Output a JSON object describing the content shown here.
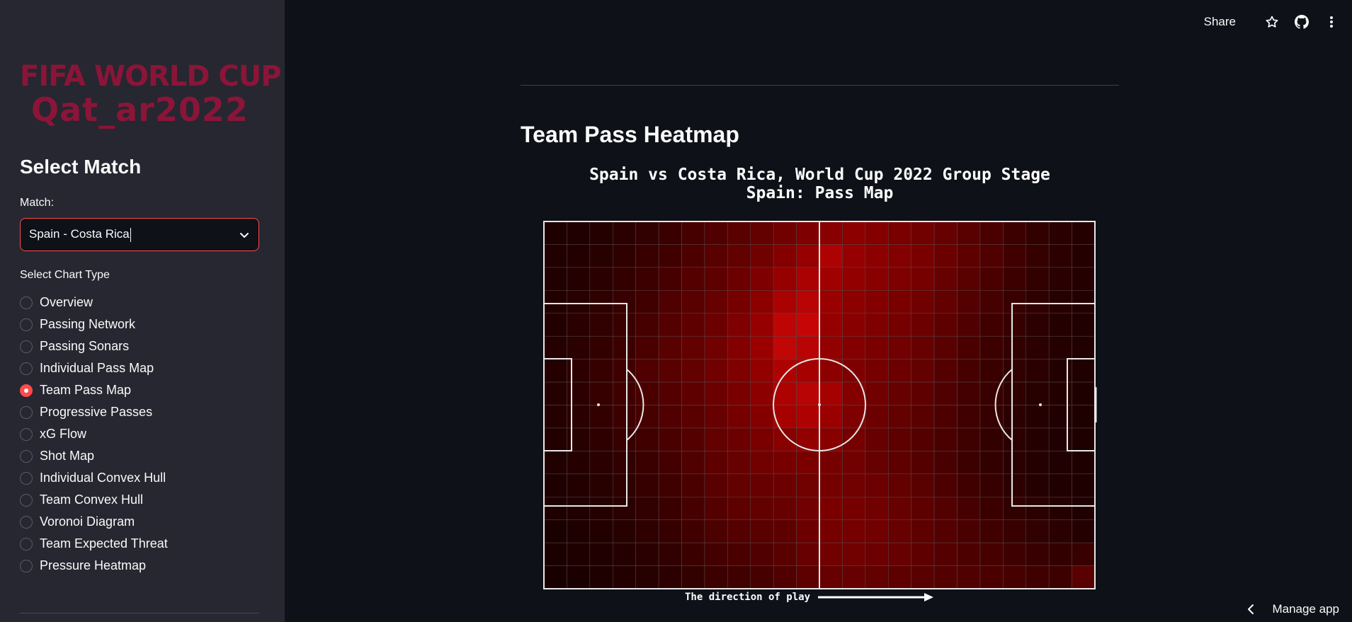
{
  "sidebar": {
    "logo": {
      "line1": "FIFA WORLD CUP",
      "line2": "Qat_ar2022"
    },
    "heading": "Select Match",
    "match_label": "Match:",
    "match_value": "Spain - Costa Rica",
    "chart_type_label": "Select Chart Type",
    "chart_types": [
      {
        "label": "Overview",
        "selected": false
      },
      {
        "label": "Passing Network",
        "selected": false
      },
      {
        "label": "Passing Sonars",
        "selected": false
      },
      {
        "label": "Individual Pass Map",
        "selected": false
      },
      {
        "label": "Team Pass Map",
        "selected": true
      },
      {
        "label": "Progressive Passes",
        "selected": false
      },
      {
        "label": "xG Flow",
        "selected": false
      },
      {
        "label": "Shot Map",
        "selected": false
      },
      {
        "label": "Individual Convex Hull",
        "selected": false
      },
      {
        "label": "Team Convex Hull",
        "selected": false
      },
      {
        "label": "Voronoi Diagram",
        "selected": false
      },
      {
        "label": "Team Expected Threat",
        "selected": false
      },
      {
        "label": "Pressure Heatmap",
        "selected": false
      }
    ]
  },
  "header": {
    "share_label": "Share",
    "icons": [
      "star-icon",
      "github-icon",
      "more-vert-icon"
    ]
  },
  "main": {
    "title": "Team Pass Heatmap",
    "chart_title_line1": "Spain vs Costa Rica, World Cup 2022 Group Stage",
    "chart_title_line2": "Spain: Pass Map",
    "direction_label": "The direction of play"
  },
  "footer": {
    "manage_label": "Manage app"
  },
  "colors": {
    "accent": "#ff4b4b",
    "sidebar_bg": "#262730",
    "main_bg": "#0e1117",
    "logo": "#8a1538"
  },
  "chart_data": {
    "type": "heatmap",
    "title": "Spain vs Costa Rica, World Cup 2022 Group Stage",
    "subtitle": "Spain: Pass Map",
    "cols": 24,
    "rows": 16,
    "value_range": [
      0,
      1
    ],
    "values": [
      [
        0.05,
        0.06,
        0.08,
        0.1,
        0.13,
        0.17,
        0.22,
        0.26,
        0.3,
        0.34,
        0.4,
        0.46,
        0.5,
        0.52,
        0.48,
        0.44,
        0.4,
        0.36,
        0.3,
        0.24,
        0.18,
        0.14,
        0.1,
        0.08
      ],
      [
        0.06,
        0.07,
        0.09,
        0.12,
        0.16,
        0.2,
        0.25,
        0.3,
        0.34,
        0.4,
        0.48,
        0.56,
        0.66,
        0.56,
        0.52,
        0.48,
        0.44,
        0.38,
        0.32,
        0.26,
        0.2,
        0.15,
        0.11,
        0.08
      ],
      [
        0.06,
        0.08,
        0.1,
        0.14,
        0.18,
        0.22,
        0.28,
        0.32,
        0.38,
        0.46,
        0.56,
        0.64,
        0.6,
        0.54,
        0.5,
        0.46,
        0.42,
        0.36,
        0.3,
        0.24,
        0.18,
        0.14,
        0.1,
        0.08
      ],
      [
        0.07,
        0.09,
        0.12,
        0.16,
        0.2,
        0.26,
        0.3,
        0.36,
        0.42,
        0.52,
        0.64,
        0.7,
        0.58,
        0.52,
        0.48,
        0.44,
        0.4,
        0.34,
        0.28,
        0.22,
        0.16,
        0.12,
        0.09,
        0.07
      ],
      [
        0.07,
        0.1,
        0.13,
        0.17,
        0.22,
        0.28,
        0.32,
        0.38,
        0.46,
        0.56,
        0.72,
        0.76,
        0.56,
        0.5,
        0.46,
        0.42,
        0.38,
        0.32,
        0.26,
        0.2,
        0.15,
        0.11,
        0.08,
        0.06
      ],
      [
        0.08,
        0.1,
        0.14,
        0.18,
        0.24,
        0.3,
        0.34,
        0.4,
        0.48,
        0.58,
        0.74,
        0.7,
        0.54,
        0.48,
        0.44,
        0.4,
        0.36,
        0.3,
        0.24,
        0.18,
        0.14,
        0.1,
        0.08,
        0.06
      ],
      [
        0.08,
        0.11,
        0.15,
        0.2,
        0.26,
        0.3,
        0.34,
        0.4,
        0.46,
        0.54,
        0.66,
        0.62,
        0.52,
        0.46,
        0.42,
        0.38,
        0.34,
        0.28,
        0.22,
        0.17,
        0.13,
        0.1,
        0.07,
        0.06
      ],
      [
        0.08,
        0.11,
        0.15,
        0.2,
        0.24,
        0.28,
        0.32,
        0.38,
        0.44,
        0.52,
        0.66,
        0.7,
        0.62,
        0.48,
        0.4,
        0.36,
        0.32,
        0.26,
        0.21,
        0.16,
        0.12,
        0.09,
        0.07,
        0.05
      ],
      [
        0.08,
        0.1,
        0.14,
        0.18,
        0.22,
        0.26,
        0.3,
        0.36,
        0.42,
        0.48,
        0.62,
        0.66,
        0.58,
        0.46,
        0.38,
        0.34,
        0.3,
        0.25,
        0.2,
        0.15,
        0.11,
        0.08,
        0.06,
        0.05
      ],
      [
        0.07,
        0.09,
        0.12,
        0.16,
        0.2,
        0.24,
        0.28,
        0.34,
        0.38,
        0.44,
        0.5,
        0.54,
        0.5,
        0.42,
        0.36,
        0.32,
        0.28,
        0.24,
        0.19,
        0.14,
        0.11,
        0.08,
        0.06,
        0.05
      ],
      [
        0.06,
        0.08,
        0.1,
        0.13,
        0.17,
        0.21,
        0.26,
        0.32,
        0.36,
        0.4,
        0.42,
        0.44,
        0.42,
        0.4,
        0.36,
        0.32,
        0.28,
        0.23,
        0.18,
        0.14,
        0.1,
        0.08,
        0.06,
        0.05
      ],
      [
        0.05,
        0.07,
        0.09,
        0.12,
        0.15,
        0.19,
        0.24,
        0.3,
        0.34,
        0.36,
        0.38,
        0.4,
        0.42,
        0.4,
        0.38,
        0.34,
        0.3,
        0.25,
        0.2,
        0.15,
        0.11,
        0.08,
        0.06,
        0.05
      ],
      [
        0.05,
        0.06,
        0.08,
        0.1,
        0.13,
        0.17,
        0.22,
        0.28,
        0.32,
        0.34,
        0.36,
        0.4,
        0.44,
        0.42,
        0.4,
        0.36,
        0.32,
        0.27,
        0.22,
        0.17,
        0.13,
        0.1,
        0.08,
        0.06
      ],
      [
        0.04,
        0.05,
        0.07,
        0.09,
        0.12,
        0.15,
        0.2,
        0.25,
        0.28,
        0.3,
        0.32,
        0.38,
        0.42,
        0.42,
        0.4,
        0.36,
        0.32,
        0.28,
        0.24,
        0.2,
        0.16,
        0.13,
        0.1,
        0.08
      ],
      [
        0.04,
        0.05,
        0.06,
        0.08,
        0.1,
        0.13,
        0.17,
        0.21,
        0.24,
        0.26,
        0.3,
        0.36,
        0.4,
        0.4,
        0.38,
        0.36,
        0.32,
        0.28,
        0.25,
        0.22,
        0.19,
        0.16,
        0.14,
        0.16
      ],
      [
        0.03,
        0.04,
        0.05,
        0.07,
        0.09,
        0.11,
        0.14,
        0.18,
        0.2,
        0.22,
        0.26,
        0.32,
        0.36,
        0.36,
        0.34,
        0.32,
        0.3,
        0.28,
        0.26,
        0.24,
        0.22,
        0.2,
        0.18,
        0.3
      ]
    ]
  }
}
